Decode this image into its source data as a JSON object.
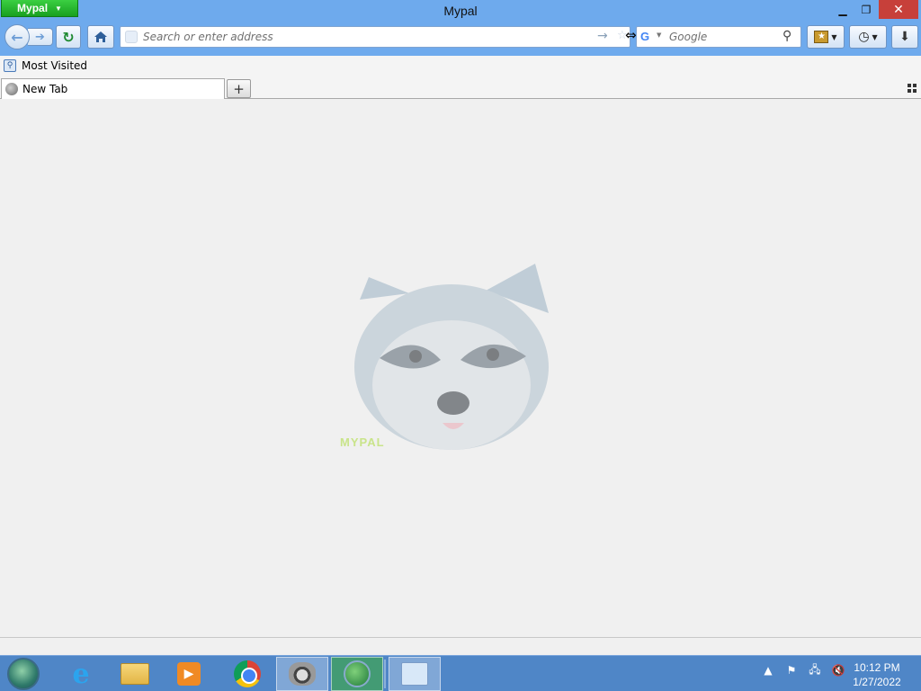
{
  "window": {
    "title": "Mypal",
    "app_menu_label": "Mypal"
  },
  "nav": {
    "url_placeholder": "Search or enter address",
    "search_engine": "G",
    "search_placeholder": "Google"
  },
  "bookmarks_bar": {
    "items": [
      {
        "label": "Most Visited",
        "icon": "most-visited-icon"
      }
    ]
  },
  "tabs": [
    {
      "label": "New Tab",
      "icon": "globe-icon",
      "active": true
    }
  ],
  "content": {
    "logo": "raccoon-logo",
    "logo_word": "MYPAL"
  },
  "taskbar": {
    "apps": [
      {
        "name": "Internet Explorer",
        "icon": "ie-icon"
      },
      {
        "name": "File Explorer",
        "icon": "folder-icon"
      },
      {
        "name": "Media Player",
        "icon": "media-icon"
      },
      {
        "name": "Google Chrome",
        "icon": "chrome-icon"
      },
      {
        "name": "Mypal",
        "icon": "raccoon-icon",
        "active": true
      },
      {
        "name": "Internet Download Manager",
        "icon": "idm-icon",
        "active": true
      },
      {
        "name": "Control Panel",
        "icon": "control-panel-icon",
        "active": true
      }
    ],
    "clock": {
      "time": "10:12 PM",
      "date": "1/27/2022"
    }
  },
  "colors": {
    "titlebar": "#6eaaed",
    "app_menu": "#18a01f",
    "close": "#c7403a",
    "taskbar": "#4f86c7"
  }
}
